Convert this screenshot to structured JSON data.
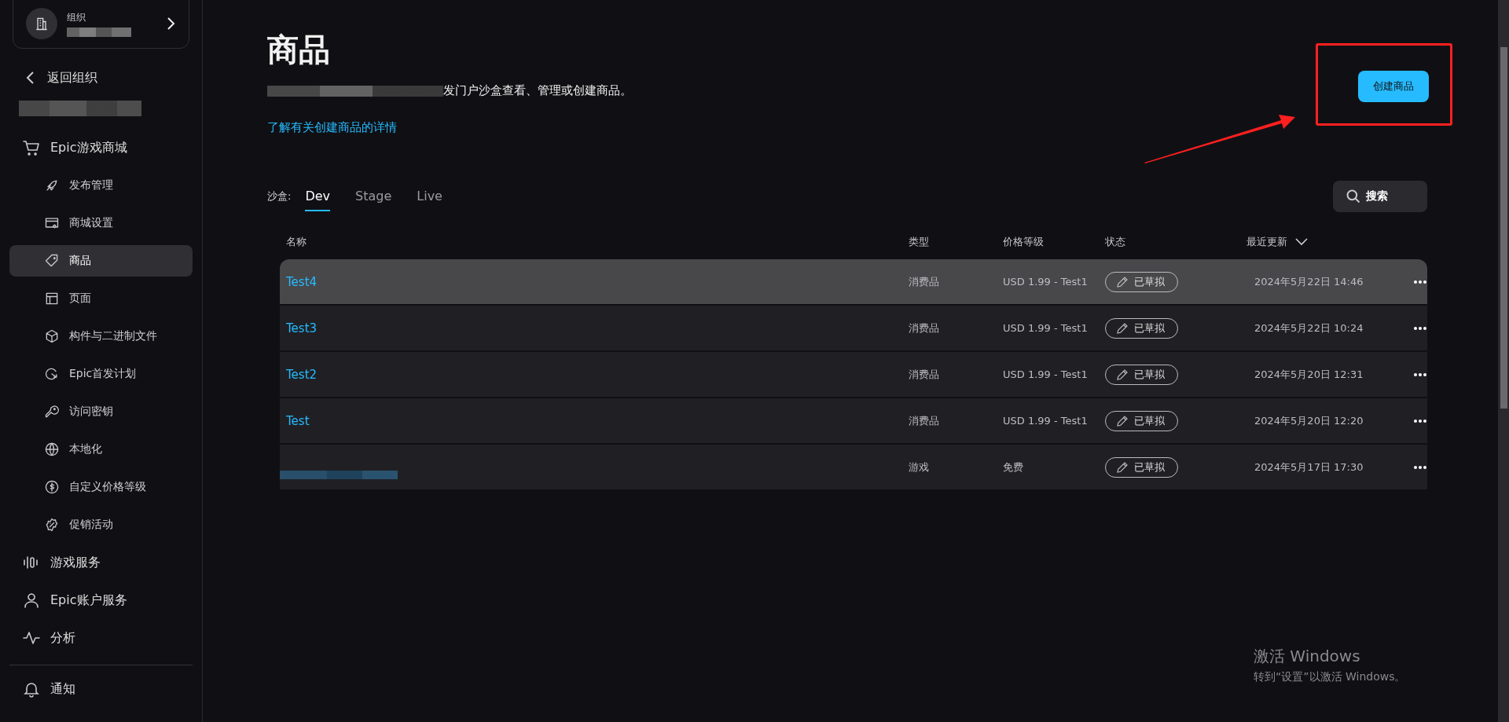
{
  "org_card": {
    "label": "组织"
  },
  "back_link": "返回组织",
  "nav": [
    {
      "label": "Epic游戏商城",
      "selected": false,
      "children": [
        {
          "label": "发布管理",
          "selected": false
        },
        {
          "label": "商城设置",
          "selected": false
        },
        {
          "label": "商品",
          "selected": true
        },
        {
          "label": "页面",
          "selected": false
        },
        {
          "label": "构件与二进制文件",
          "selected": false
        },
        {
          "label": "Epic首发计划",
          "selected": false
        },
        {
          "label": "访问密钥",
          "selected": false
        },
        {
          "label": "本地化",
          "selected": false
        },
        {
          "label": "自定义价格等级",
          "selected": false
        },
        {
          "label": "促销活动",
          "selected": false
        }
      ]
    },
    {
      "label": "游戏服务",
      "selected": false
    },
    {
      "label": "Epic账户服务",
      "selected": false
    },
    {
      "label": "分析",
      "selected": false
    }
  ],
  "notifications": "通知",
  "page": {
    "title": "商品",
    "description": "发门户沙盒查看、管理或创建商品。",
    "learn_link": "了解有关创建商品的详情",
    "create_button": "创建商品"
  },
  "sandbox": {
    "label": "沙盒:",
    "tabs": [
      {
        "label": "Dev",
        "selected": true
      },
      {
        "label": "Stage",
        "selected": false
      },
      {
        "label": "Live",
        "selected": false
      }
    ]
  },
  "search_button": "搜索",
  "table": {
    "columns": [
      "名称",
      "类型",
      "价格等级",
      "状态",
      "最近更新"
    ],
    "rows": [
      {
        "name": "Test4",
        "type": "消费品",
        "price": "USD 1.99 - Test1",
        "status": "已草拟",
        "updated": "2024年5月22日 14:46",
        "selected": true
      },
      {
        "name": "Test3",
        "type": "消费品",
        "price": "USD 1.99 - Test1",
        "status": "已草拟",
        "updated": "2024年5月22日 10:24",
        "selected": false
      },
      {
        "name": "Test2",
        "type": "消费品",
        "price": "USD 1.99 - Test1",
        "status": "已草拟",
        "updated": "2024年5月20日 12:31",
        "selected": false
      },
      {
        "name": "Test",
        "type": "消费品",
        "price": "USD 1.99 - Test1",
        "status": "已草拟",
        "updated": "2024年5月20日 12:20",
        "selected": false
      },
      {
        "type": "游戏",
        "price": "免费",
        "status": "已草拟",
        "updated": "2024年5月17日 17:30",
        "selected": false
      }
    ]
  },
  "activation_notice": {
    "title": "激活 Windows",
    "message": "转到“设置”以激活 Windows。"
  }
}
